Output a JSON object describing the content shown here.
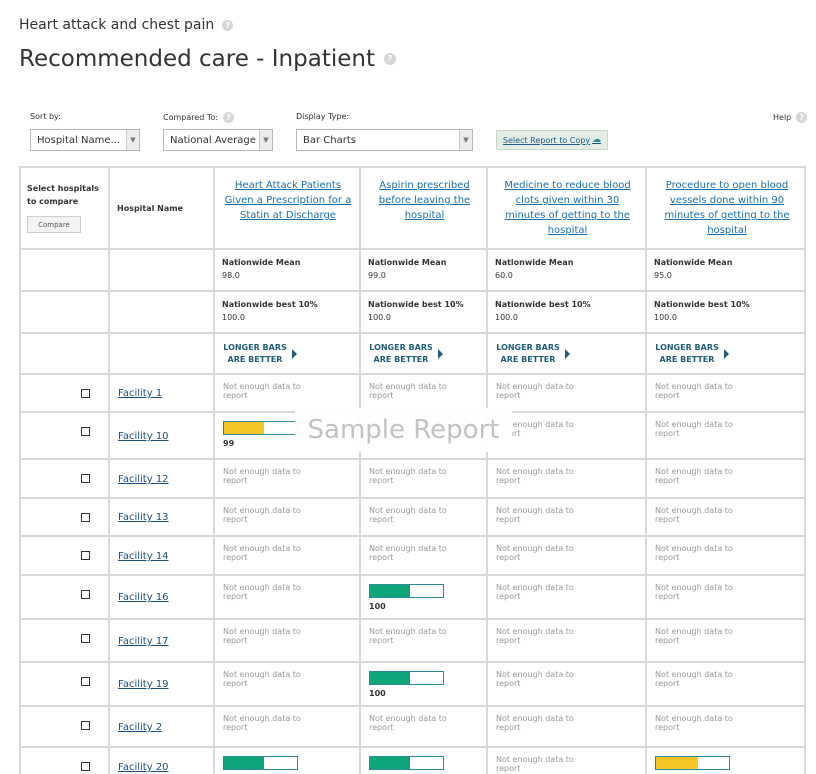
{
  "header": {
    "subtitle": "Heart attack and chest pain",
    "title": "Recommended care - Inpatient"
  },
  "controls": {
    "sort_label": "Sort by:",
    "sort_value": "Hospital Name...",
    "compared_label": "Compared To:",
    "compared_value": "National Average",
    "display_label": "Display Type:",
    "display_value": "Bar Charts",
    "copy_label": "Select Report to Copy",
    "help_label": "Help"
  },
  "table": {
    "select_header": "Select hospitals to compare",
    "compare_button": "Compare",
    "name_header": "Hospital Name",
    "measures": [
      {
        "title": "Heart Attack Patients Given a Prescription for a Statin at Discharge",
        "mean_label": "Nationwide Mean",
        "mean": "98.0",
        "best_label": "Nationwide best 10%",
        "best": "100.0",
        "direction": "LONGER BARS ARE BETTER"
      },
      {
        "title": "Aspirin prescribed before leaving the hospital",
        "mean_label": "Nationwide Mean",
        "mean": "99.0",
        "best_label": "Nationwide best 10%",
        "best": "100.0",
        "direction": "LONGER BARS ARE BETTER"
      },
      {
        "title": "Medicine to reduce blood clots given within 30 minutes of getting to the hospital",
        "mean_label": "Nationwide Mean",
        "mean": "60.0",
        "best_label": "Nationwide best 10%",
        "best": "100.0",
        "direction": "LONGER BARS ARE BETTER"
      },
      {
        "title": "Procedure to open blood vessels done within 90 minutes of getting to the hospital",
        "mean_label": "Nationwide Mean",
        "mean": "95.0",
        "best_label": "Nationwide best 10%",
        "best": "100.0",
        "direction": "LONGER BARS ARE BETTER"
      }
    ],
    "not_enough": "Not enough data to report",
    "rows": [
      {
        "name": "Facility 1"
      },
      {
        "name": "Facility 10"
      },
      {
        "name": "Facility 12"
      },
      {
        "name": "Facility 13"
      },
      {
        "name": "Facility 14"
      },
      {
        "name": "Facility 16"
      },
      {
        "name": "Facility 17"
      },
      {
        "name": "Facility 19"
      },
      {
        "name": "Facility 2"
      },
      {
        "name": "Facility 20"
      }
    ],
    "bars": {
      "r1c0": {
        "value": "99",
        "fill_fraction": 0.55,
        "color": "#f5c528"
      },
      "r5c1": {
        "value": "100",
        "fill_fraction": 0.55,
        "color": "#0fa57a"
      },
      "r7c1": {
        "value": "100",
        "fill_fraction": 0.55,
        "color": "#0fa57a"
      },
      "r9c0": {
        "fill_fraction": 0.55,
        "color": "#0fa57a"
      },
      "r9c1": {
        "fill_fraction": 0.55,
        "color": "#0fa57a"
      },
      "r9c3": {
        "fill_fraction": 0.57,
        "color": "#f5c528"
      }
    }
  },
  "watermark": "Sample Report"
}
